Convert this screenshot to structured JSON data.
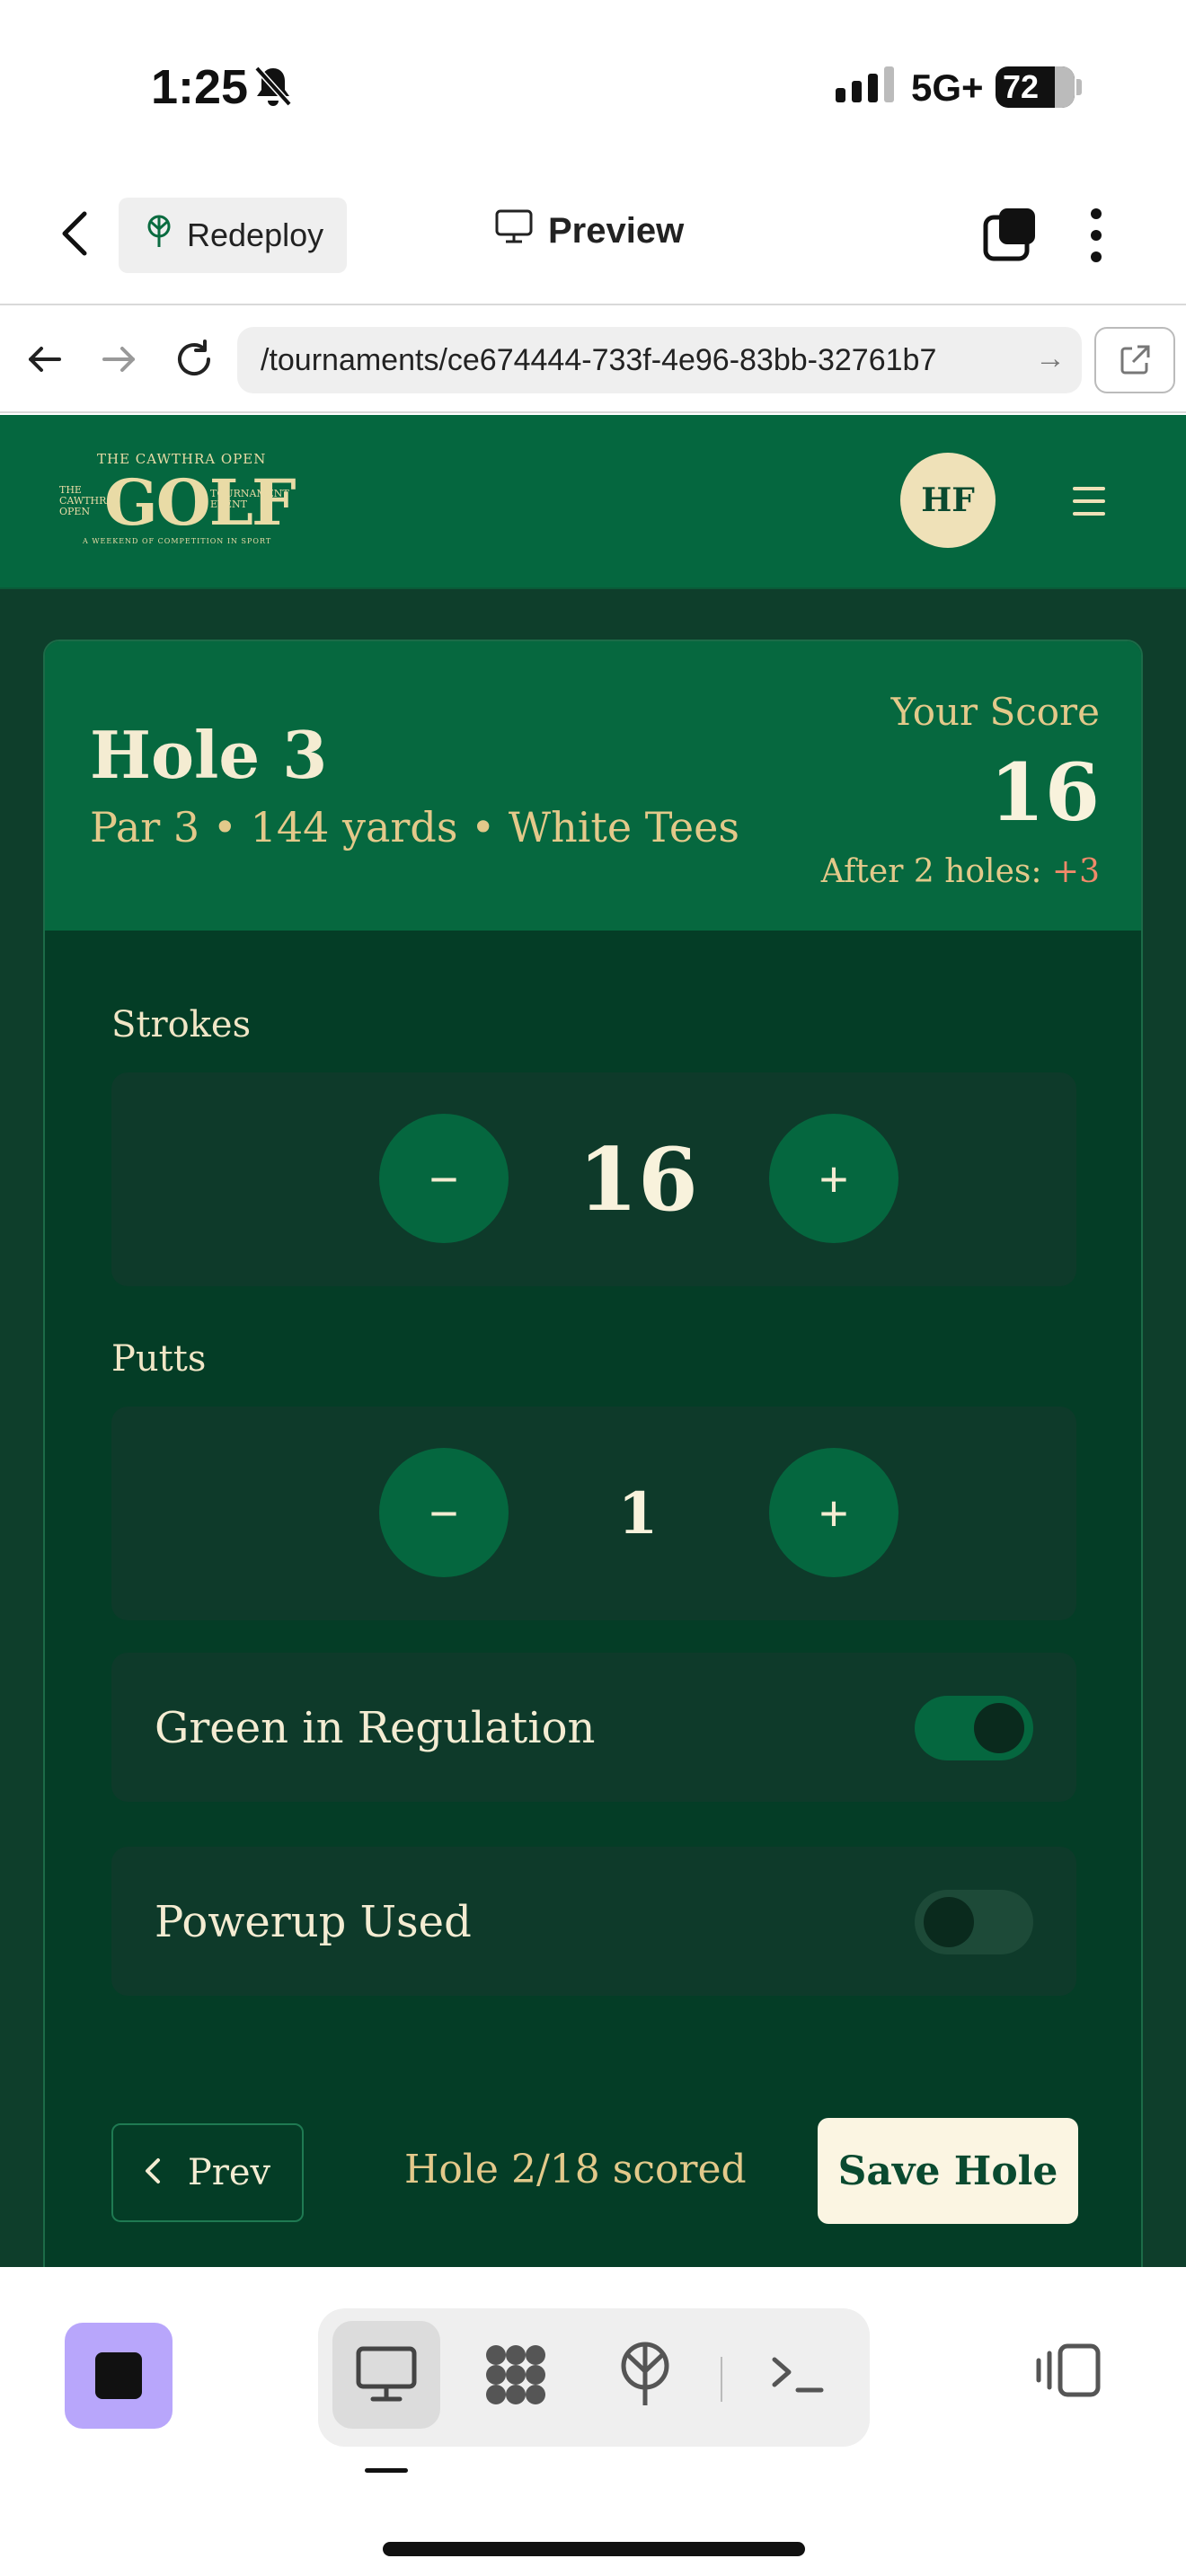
{
  "status_bar": {
    "time": "1:25",
    "network": "5G+",
    "battery": "72"
  },
  "app_header": {
    "redeploy_label": "Redeploy",
    "preview_label": "Preview"
  },
  "browser": {
    "url": "/tournaments/ce674444-733f-4e96-83bb-32761b7"
  },
  "site_header": {
    "logo": {
      "top": "THE CAWTHRA OPEN",
      "main": "GOLF",
      "left_small": "THE CAWTHRA OPEN",
      "right_small": "TOURNAMENT EVENT",
      "bottom": "A WEEKEND OF COMPETITION IN SPORT"
    },
    "avatar_initials": "HF"
  },
  "hole": {
    "title": "Hole 3",
    "subtitle": "Par 3 • 144 yards • White Tees",
    "your_score_label": "Your Score",
    "your_score": "16",
    "after_label": "After 2 holes: ",
    "after_delta": "+3"
  },
  "strokes": {
    "label": "Strokes",
    "value": "16",
    "minus": "−",
    "plus": "+"
  },
  "putts": {
    "label": "Putts",
    "value": "1",
    "minus": "−",
    "plus": "+"
  },
  "toggles": [
    {
      "label": "Green in Regulation",
      "on": true
    },
    {
      "label": "Powerup Used",
      "on": false
    }
  ],
  "footer": {
    "prev_label": "Prev",
    "progress": "Hole 2/18 scored",
    "save_label": "Save Hole"
  },
  "colors": {
    "site_header_green": "#05673f",
    "card_dark_green": "#043d26",
    "cream": "#f4ecd2",
    "gold": "#e3c98a",
    "delta_red": "#f08a6a",
    "stop_purple": "#b8a6fb"
  }
}
